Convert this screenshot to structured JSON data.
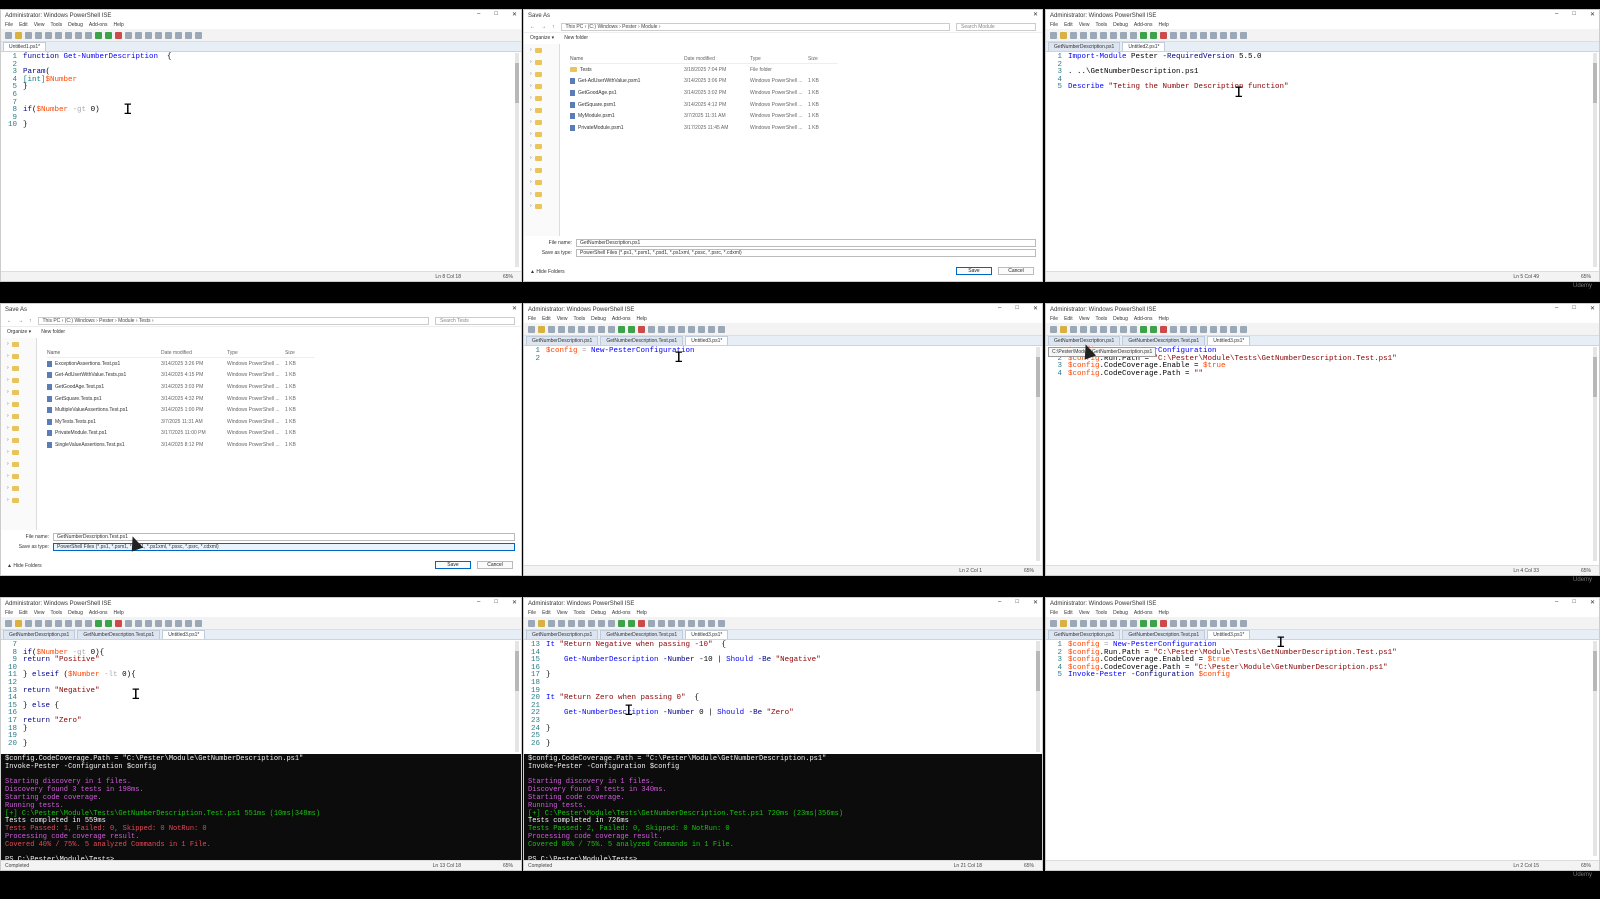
{
  "watermark": "Udemy",
  "ise": {
    "title": "Administrator: Windows PowerShell ISE",
    "menu": [
      "File",
      "Edit",
      "View",
      "Tools",
      "Debug",
      "Add-ons",
      "Help"
    ],
    "status_completed": "Completed",
    "zoom": "65%"
  },
  "p1": {
    "tabs": [
      "Untitled1.ps1*"
    ],
    "status_pos": "Ln 8  Col 18",
    "code": [
      [
        [
          "kw",
          "function "
        ],
        [
          "cmd",
          "Get-NumberDescription"
        ],
        [
          "",
          "  {"
        ]
      ],
      [
        [
          "",
          ""
        ]
      ],
      [
        [
          "kw",
          "Param"
        ],
        [
          "",
          "("
        ]
      ],
      [
        [
          "typ",
          "[int]"
        ],
        [
          "var",
          "$Number"
        ]
      ],
      [
        [
          "",
          "}"
        ]
      ],
      [
        [
          "",
          ""
        ]
      ],
      [
        [
          "",
          ""
        ]
      ],
      [
        [
          "kw",
          "if"
        ],
        [
          "",
          "("
        ],
        [
          "var",
          "$Number"
        ],
        [
          "op",
          " -gt "
        ],
        [
          "",
          "0)"
        ]
      ],
      [
        [
          "",
          ""
        ]
      ],
      [
        [
          "",
          "}"
        ]
      ]
    ]
  },
  "p2": {
    "title": "Save As",
    "path": [
      "This PC",
      "(C:) Windows",
      "Pester",
      "Module"
    ],
    "search": "Search Module",
    "organize": "Organize",
    "new_folder": "New folder",
    "headers": [
      "Name",
      "Date modified",
      "Type",
      "Size"
    ],
    "rows": [
      {
        "name": "Tests",
        "date": "3/18/2025 7:04 PM",
        "type": "File folder",
        "size": "",
        "folder": true
      },
      {
        "name": "Get-AdUserWithValue.psm1",
        "date": "3/14/2025 3:06 PM",
        "type": "Windows PowerShell ...",
        "size": "1 KB",
        "folder": false
      },
      {
        "name": "GetGoodAge.ps1",
        "date": "3/14/2025 3:02 PM",
        "type": "Windows PowerShell ...",
        "size": "1 KB",
        "folder": false
      },
      {
        "name": "GetSquare.psm1",
        "date": "3/14/2025 4:12 PM",
        "type": "Windows PowerShell ...",
        "size": "1 KB",
        "folder": false
      },
      {
        "name": "MyModule.psm1",
        "date": "3/7/2025 11:31 AM",
        "type": "Windows PowerShell ...",
        "size": "1 KB",
        "folder": false
      },
      {
        "name": "PrivateModule.psm1",
        "date": "3/17/2025 11:45 AM",
        "type": "Windows PowerShell ...",
        "size": "1 KB",
        "folder": false
      }
    ],
    "file_name_label": "File name:",
    "file_name": "GetNumberDescription.ps1",
    "type_label": "Save as type:",
    "type_value": "PowerShell Files (*.ps1, *.psm1, *.psd1, *.ps1xml, *.pssc, *.psrc, *.cdxml)",
    "save": "Save",
    "cancel": "Cancel",
    "hide_folders": "Hide Folders"
  },
  "p3": {
    "tabs": [
      "GetNumberDescription.ps1",
      "Untitled2.ps1*"
    ],
    "status_pos": "Ln 5  Col 49",
    "code": [
      [
        [
          "cmd",
          "Import-Module "
        ],
        [
          "",
          "Pester "
        ],
        [
          "prm",
          "-RequiredVersion "
        ],
        [
          "",
          "5.5.0"
        ]
      ],
      [
        [
          "",
          ""
        ]
      ],
      [
        [
          "",
          ". "
        ],
        [
          "",
          "..\\GetNumberDescription.ps1"
        ]
      ],
      [
        [
          "",
          ""
        ]
      ],
      [
        [
          "cmd",
          "Describe "
        ],
        [
          "str",
          "\"Teting the Number Description function\""
        ]
      ]
    ]
  },
  "p4": {
    "title": "Save As",
    "path": [
      "This PC",
      "(C:) Windows",
      "Pester",
      "Module",
      "Tests"
    ],
    "search": "Search Tests",
    "organize": "Organize",
    "new_folder": "New folder",
    "headers": [
      "Name",
      "Date modified",
      "Type",
      "Size"
    ],
    "rows": [
      {
        "name": "ExceptionAssertions.Test.ps1",
        "date": "3/14/2025 3:26 PM",
        "type": "Windows PowerShell ...",
        "size": "1 KB"
      },
      {
        "name": "Get-AdUserWithValue.Tests.ps1",
        "date": "3/14/2025 4:15 PM",
        "type": "Windows PowerShell ...",
        "size": "1 KB"
      },
      {
        "name": "GetGoodAge.Test.ps1",
        "date": "3/14/2025 3:03 PM",
        "type": "Windows PowerShell ...",
        "size": "1 KB"
      },
      {
        "name": "GetSquare.Tests.ps1",
        "date": "3/14/2025 4:32 PM",
        "type": "Windows PowerShell ...",
        "size": "1 KB"
      },
      {
        "name": "MultipleValueAssertions.Test.ps1",
        "date": "3/14/2025 1:00 PM",
        "type": "Windows PowerShell ...",
        "size": "1 KB"
      },
      {
        "name": "MyTests.Tests.ps1",
        "date": "3/7/2025 11:31 AM",
        "type": "Windows PowerShell ...",
        "size": "1 KB"
      },
      {
        "name": "PrivateModule.Test.ps1",
        "date": "3/17/2025 11:00 PM",
        "type": "Windows PowerShell ...",
        "size": "1 KB"
      },
      {
        "name": "SingleValueAssertions.Test.ps1",
        "date": "3/14/2025 8:12 PM",
        "type": "Windows PowerShell ...",
        "size": "1 KB"
      }
    ],
    "file_name_label": "File name:",
    "file_name": "GetNumberDescription.Test.ps1",
    "type_label": "Save as type:",
    "type_value": "PowerShell Files (*.ps1, *.psm1, *.psd1, *.ps1xml, *.pssc, *.psrc, *.cdxml)",
    "save": "Save",
    "cancel": "Cancel",
    "hide_folders": "Hide Folders"
  },
  "p5": {
    "tabs": [
      "GetNumberDescription.ps1",
      "GetNumberDescription.Test.ps1",
      "Untitled3.ps1*"
    ],
    "status_pos": "Ln 2  Col 1",
    "code": [
      [
        [
          "var",
          "$config"
        ],
        [
          "op",
          " = "
        ],
        [
          "cmd",
          "New-PesterConfiguration"
        ]
      ],
      [
        [
          "",
          ""
        ]
      ]
    ]
  },
  "p6": {
    "tabs": [
      "GetNumberDescription.ps1",
      "GetNumberDescription.Test.ps1",
      "Untitled3.ps1*"
    ],
    "tooltip": "C:\\Pester\\Module\\GetNumberDescription.ps1",
    "status_pos": "Ln 4  Col 33",
    "code": [
      [
        [
          "var",
          "$config"
        ],
        [
          "op",
          " = "
        ],
        [
          "cmd",
          "New-PesterConfiguration"
        ]
      ],
      [
        [
          "var",
          "$config"
        ],
        [
          "",
          ".Run.Path = "
        ],
        [
          "str",
          "\"C:\\Pester\\Module\\Tests\\GetNumberDescription.Test.ps1\""
        ]
      ],
      [
        [
          "var",
          "$config"
        ],
        [
          "",
          ".CodeCoverage.Enable = "
        ],
        [
          "var",
          "$true"
        ]
      ],
      [
        [
          "var",
          "$config"
        ],
        [
          "",
          ".CodeCoverage.Path = "
        ],
        [
          "str",
          "\"\""
        ]
      ]
    ]
  },
  "p7": {
    "tabs": [
      "GetNumberDescription.ps1",
      "GetNumberDescription.Test.ps1",
      "Untitled3.ps1*"
    ],
    "status_pos": "Ln 13  Col 18",
    "first_ln": 7,
    "code": [
      [
        [
          "",
          ""
        ]
      ],
      [
        [
          "kw",
          "if"
        ],
        [
          "",
          "("
        ],
        [
          "var",
          "$Number"
        ],
        [
          "op",
          " -gt "
        ],
        [
          "",
          "0){"
        ]
      ],
      [
        [
          "kw",
          "return "
        ],
        [
          "str",
          "\"Positive\""
        ]
      ],
      [
        [
          "",
          ""
        ]
      ],
      [
        [
          "",
          "} "
        ],
        [
          "kw",
          "elseif "
        ],
        [
          "",
          "("
        ],
        [
          "var",
          "$Number"
        ],
        [
          "op",
          " -lt "
        ],
        [
          "",
          "0){"
        ]
      ],
      [
        [
          "",
          ""
        ]
      ],
      [
        [
          "kw",
          "return "
        ],
        [
          "str",
          "\"Negative\""
        ]
      ],
      [
        [
          "",
          ""
        ]
      ],
      [
        [
          "",
          "} "
        ],
        [
          "kw",
          "else "
        ],
        [
          "",
          "{"
        ]
      ],
      [
        [
          "",
          ""
        ]
      ],
      [
        [
          "kw",
          "return "
        ],
        [
          "str",
          "\"Zero\""
        ]
      ],
      [
        [
          "",
          "}"
        ]
      ],
      [
        [
          "",
          ""
        ]
      ],
      [
        [
          "",
          "}"
        ]
      ]
    ],
    "console": [
      [
        "c-wht",
        "$config.CodeCoverage.Path = \"C:\\Pester\\Module\\GetNumberDescription.ps1\""
      ],
      [
        "c-wht",
        "Invoke-Pester -Configuration $config"
      ],
      [
        "",
        ""
      ],
      [
        "c-mag",
        "Starting discovery in 1 files."
      ],
      [
        "c-mag",
        "Discovery found 3 tests in 198ms."
      ],
      [
        "c-mag",
        "Starting code coverage."
      ],
      [
        "c-mag",
        "Running tests."
      ],
      [
        "c-grn",
        "[+] C:\\Pester\\Module\\Tests\\GetNumberDescription.Test.ps1 551ms (10ms|348ms)"
      ],
      [
        "c-wht",
        "Tests completed in 559ms"
      ],
      [
        "c-red",
        "Tests Passed: 1, Failed: 0, Skipped: 0 NotRun: 0"
      ],
      [
        "c-mag",
        "Processing code coverage result."
      ],
      [
        "c-red",
        "Covered 40% / 75%. 5 analyzed Commands in 1 File."
      ],
      [
        "",
        ""
      ],
      [
        "c-wht",
        "PS C:\\Pester\\Module\\Tests>"
      ]
    ]
  },
  "p8": {
    "tabs": [
      "GetNumberDescription.ps1",
      "GetNumberDescription.Test.ps1",
      "Untitled3.ps1*"
    ],
    "status_pos": "Ln 21  Col 18",
    "first_ln": 13,
    "code": [
      [
        [
          "cmd",
          "It "
        ],
        [
          "str",
          "\"Return Negative when passing -10\""
        ],
        [
          "",
          "  {"
        ]
      ],
      [
        [
          "",
          ""
        ]
      ],
      [
        [
          "",
          "    "
        ],
        [
          "cmd",
          "Get-NumberDescription "
        ],
        [
          "prm",
          "-Number "
        ],
        [
          "",
          "-10 | "
        ],
        [
          "cmd",
          "Should "
        ],
        [
          "prm",
          "-Be "
        ],
        [
          "str",
          "\"Negative\""
        ]
      ],
      [
        [
          "",
          ""
        ]
      ],
      [
        [
          "",
          "}"
        ]
      ],
      [
        [
          "",
          ""
        ]
      ],
      [
        [
          "",
          ""
        ]
      ],
      [
        [
          "cmd",
          "It "
        ],
        [
          "str",
          "\"Return Zero when passing 0\""
        ],
        [
          "",
          "  {"
        ]
      ],
      [
        [
          "",
          ""
        ]
      ],
      [
        [
          "",
          "    "
        ],
        [
          "cmd",
          "Get-NumberDescription "
        ],
        [
          "prm",
          "-Number "
        ],
        [
          "",
          "0 | "
        ],
        [
          "cmd",
          "Should "
        ],
        [
          "prm",
          "-Be "
        ],
        [
          "str",
          "\"Zero\""
        ]
      ],
      [
        [
          "",
          ""
        ]
      ],
      [
        [
          "",
          "}"
        ]
      ],
      [
        [
          "",
          ""
        ]
      ],
      [
        [
          "",
          "}"
        ]
      ]
    ],
    "console": [
      [
        "c-wht",
        "$config.CodeCoverage.Path = \"C:\\Pester\\Module\\GetNumberDescription.ps1\""
      ],
      [
        "c-wht",
        "Invoke-Pester -Configuration $config"
      ],
      [
        "",
        ""
      ],
      [
        "c-mag",
        "Starting discovery in 1 files."
      ],
      [
        "c-mag",
        "Discovery found 3 tests in 340ms."
      ],
      [
        "c-mag",
        "Starting code coverage."
      ],
      [
        "c-mag",
        "Running tests."
      ],
      [
        "c-grn",
        "[+] C:\\Pester\\Module\\Tests\\GetNumberDescription.Test.ps1 720ms (23ms|356ms)"
      ],
      [
        "c-wht",
        "Tests completed in 726ms"
      ],
      [
        "c-grn",
        "Tests Passed: 2, Failed: 0, Skipped: 0 NotRun: 0"
      ],
      [
        "c-mag",
        "Processing code coverage result."
      ],
      [
        "c-grn",
        "Covered 80% / 75%. 5 analyzed Commands in 1 File."
      ],
      [
        "",
        ""
      ],
      [
        "c-wht",
        "PS C:\\Pester\\Module\\Tests>"
      ]
    ]
  },
  "p9": {
    "tabs": [
      "GetNumberDescription.ps1",
      "GetNumberDescription.Test.ps1",
      "Untitled3.ps1*"
    ],
    "status_pos": "Ln 2  Col 15",
    "code": [
      [
        [
          "var",
          "$config"
        ],
        [
          "op",
          " = "
        ],
        [
          "cmd",
          "New-PesterConfiguration"
        ]
      ],
      [
        [
          "var",
          "$config"
        ],
        [
          "",
          ".Run.Path = "
        ],
        [
          "str",
          "\"C:\\Pester\\Module\\Tests\\GetNumberDescription.Test.ps1\""
        ]
      ],
      [
        [
          "var",
          "$config"
        ],
        [
          "",
          ".CodeCoverage.Enabled = "
        ],
        [
          "var",
          "$true"
        ]
      ],
      [
        [
          "var",
          "$config"
        ],
        [
          "",
          ".CodeCoverage.Path = "
        ],
        [
          "str",
          "\"C:\\Pester\\Module\\GetNumberDescription.ps1\""
        ]
      ],
      [
        [
          "cmd",
          "Invoke-Pester "
        ],
        [
          "prm",
          "-Configuration "
        ],
        [
          "var",
          "$config"
        ]
      ]
    ]
  }
}
